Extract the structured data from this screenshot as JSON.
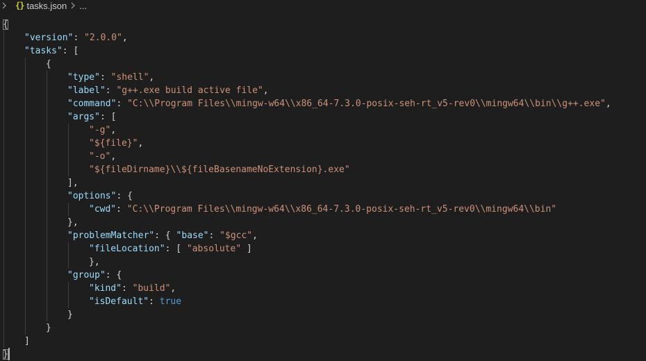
{
  "breadcrumb": {
    "file_icon": "{}",
    "file_name": "tasks.json",
    "more": "..."
  },
  "editor": {
    "lines": [
      [
        {
          "t": "p",
          "v": "{"
        }
      ],
      [
        {
          "t": "k",
          "v": "\"version\""
        },
        {
          "t": "p",
          "v": ": "
        },
        {
          "t": "s",
          "v": "\"2.0.0\""
        },
        {
          "t": "p",
          "v": ","
        }
      ],
      [
        {
          "t": "k",
          "v": "\"tasks\""
        },
        {
          "t": "p",
          "v": ": ["
        }
      ],
      [
        {
          "t": "p",
          "v": "{"
        }
      ],
      [
        {
          "t": "k",
          "v": "\"type\""
        },
        {
          "t": "p",
          "v": ": "
        },
        {
          "t": "s",
          "v": "\"shell\""
        },
        {
          "t": "p",
          "v": ","
        }
      ],
      [
        {
          "t": "k",
          "v": "\"label\""
        },
        {
          "t": "p",
          "v": ": "
        },
        {
          "t": "s",
          "v": "\"g++.exe build active file\""
        },
        {
          "t": "p",
          "v": ","
        }
      ],
      [
        {
          "t": "k",
          "v": "\"command\""
        },
        {
          "t": "p",
          "v": ": "
        },
        {
          "t": "s",
          "v": "\"C:\\\\Program Files\\\\mingw-w64\\\\x86_64-7.3.0-posix-seh-rt_v5-rev0\\\\mingw64\\\\bin\\\\g++.exe\""
        },
        {
          "t": "p",
          "v": ","
        }
      ],
      [
        {
          "t": "k",
          "v": "\"args\""
        },
        {
          "t": "p",
          "v": ": ["
        }
      ],
      [
        {
          "t": "s",
          "v": "\"-g\""
        },
        {
          "t": "p",
          "v": ","
        }
      ],
      [
        {
          "t": "s",
          "v": "\"${file}\""
        },
        {
          "t": "p",
          "v": ","
        }
      ],
      [
        {
          "t": "s",
          "v": "\"-o\""
        },
        {
          "t": "p",
          "v": ","
        }
      ],
      [
        {
          "t": "s",
          "v": "\"${fileDirname}\\\\${fileBasenameNoExtension}.exe\""
        }
      ],
      [
        {
          "t": "p",
          "v": "],"
        }
      ],
      [
        {
          "t": "k",
          "v": "\"options\""
        },
        {
          "t": "p",
          "v": ": {"
        }
      ],
      [
        {
          "t": "k",
          "v": "\"cwd\""
        },
        {
          "t": "p",
          "v": ": "
        },
        {
          "t": "s",
          "v": "\"C:\\\\Program Files\\\\mingw-w64\\\\x86_64-7.3.0-posix-seh-rt_v5-rev0\\\\mingw64\\\\bin\""
        }
      ],
      [
        {
          "t": "p",
          "v": "},"
        }
      ],
      [
        {
          "t": "k",
          "v": "\"problemMatcher\""
        },
        {
          "t": "p",
          "v": ": { "
        },
        {
          "t": "k",
          "v": "\"base\""
        },
        {
          "t": "p",
          "v": ": "
        },
        {
          "t": "s",
          "v": "\"$gcc\""
        },
        {
          "t": "p",
          "v": ","
        }
      ],
      [
        {
          "t": "k",
          "v": "\"fileLocation\""
        },
        {
          "t": "p",
          "v": ": [ "
        },
        {
          "t": "s",
          "v": "\"absolute\""
        },
        {
          "t": "p",
          "v": " ]"
        }
      ],
      [
        {
          "t": "p",
          "v": "},"
        }
      ],
      [
        {
          "t": "k",
          "v": "\"group\""
        },
        {
          "t": "p",
          "v": ": {"
        }
      ],
      [
        {
          "t": "k",
          "v": "\"kind\""
        },
        {
          "t": "p",
          "v": ": "
        },
        {
          "t": "s",
          "v": "\"build\""
        },
        {
          "t": "p",
          "v": ","
        }
      ],
      [
        {
          "t": "k",
          "v": "\"isDefault\""
        },
        {
          "t": "p",
          "v": ": "
        },
        {
          "t": "b",
          "v": "true"
        }
      ],
      [
        {
          "t": "p",
          "v": "}"
        }
      ],
      [
        {
          "t": "p",
          "v": "}"
        }
      ],
      [
        {
          "t": "p",
          "v": "]"
        }
      ],
      [
        {
          "t": "p",
          "v": "}"
        }
      ]
    ]
  },
  "colors": {
    "background": "#1e1e1e",
    "key": "#9cdcfe",
    "string": "#ce9178",
    "boolean": "#569cd6",
    "punctuation": "#d4d4d4",
    "json_icon": "#cbcb41"
  },
  "icons": {
    "breadcrumb_left": "chevron-right-icon",
    "breadcrumb_separator": "chevron-right-icon",
    "file_icon": "json-braces-icon"
  }
}
